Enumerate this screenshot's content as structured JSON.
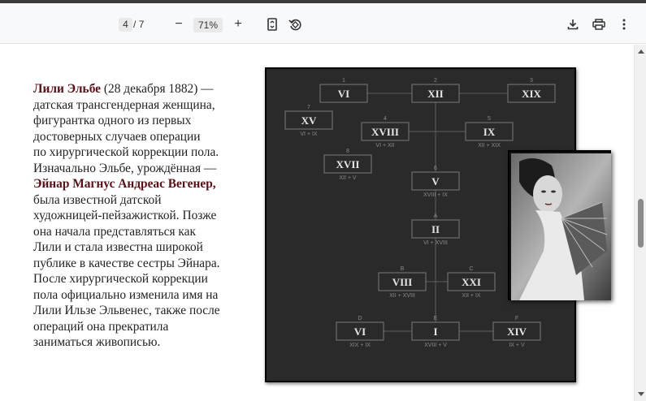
{
  "viewer": {
    "current_page": "4",
    "page_separator": "/",
    "total_pages": "7",
    "zoom_minus": "−",
    "zoom_level": "71%",
    "zoom_plus": "+"
  },
  "article": {
    "name": "Лили Эльбе",
    "l1": " (28 декабря 1882) —",
    "l2": "датская трансгендерная женщина,",
    "l3": "фигурантка одного из первых",
    "l4": "достоверных случаев операции",
    "l5": "по хирургической коррекции пола.",
    "l6": "Изначально Эльбе, урождённая —",
    "birth_name": " Эйнар Магнус Андреас Вегенер,",
    "l8": "была известной датской",
    "l9": "художницей-пейзажисткой. Позже",
    "l10": "она начала представляться как",
    "l11": "Лили и стала известна широкой",
    "l12": "публике в качестве сестры Эйнара.",
    "l13": "После хирургической коррекции",
    "l14": "пола официально изменила имя на",
    "l15": "Лили Ильзе Эльвенес, также после",
    "l16": "операций она прекратила",
    "l17": "заниматься живописью."
  },
  "diagram": {
    "nodes": [
      {
        "key": "n1",
        "tag": "1",
        "label": "VI",
        "sub": ""
      },
      {
        "key": "n2",
        "tag": "2",
        "label": "XII",
        "sub": ""
      },
      {
        "key": "n3",
        "tag": "3",
        "label": "XIX",
        "sub": ""
      },
      {
        "key": "n7",
        "tag": "7",
        "label": "XV",
        "sub": "VI + IX"
      },
      {
        "key": "n4",
        "tag": "4",
        "label": "XVIII",
        "sub": "VI + XII"
      },
      {
        "key": "n5",
        "tag": "5",
        "label": "IX",
        "sub": "XII + XIX"
      },
      {
        "key": "n8",
        "tag": "8",
        "label": "XVII",
        "sub": "XII + V"
      },
      {
        "key": "n6",
        "tag": "6",
        "label": "V",
        "sub": "XVIII + IX"
      },
      {
        "key": "nA",
        "tag": "A",
        "label": "II",
        "sub": "VI + XVIII"
      },
      {
        "key": "nB",
        "tag": "B",
        "label": "VIII",
        "sub": "XII + XVIII"
      },
      {
        "key": "nC",
        "tag": "C",
        "label": "XXI",
        "sub": "XII + IX"
      },
      {
        "key": "nD",
        "tag": "D",
        "label": "VI",
        "sub": "XIX + IX"
      },
      {
        "key": "nE",
        "tag": "E",
        "label": "I",
        "sub": "XVIII + V"
      },
      {
        "key": "nF",
        "tag": "F",
        "label": "XIV",
        "sub": "IX + V"
      }
    ]
  },
  "colors": {
    "accent_text": "#5a0f17",
    "panel_bg": "#2a2a2a",
    "node_text": "#e6e6e6",
    "node_border": "#7a7a7a"
  },
  "icons": {
    "fit_page": "fit-page-icon",
    "rotate": "rotate-icon",
    "download": "download-icon",
    "print": "print-icon",
    "more": "more-vert-icon"
  }
}
